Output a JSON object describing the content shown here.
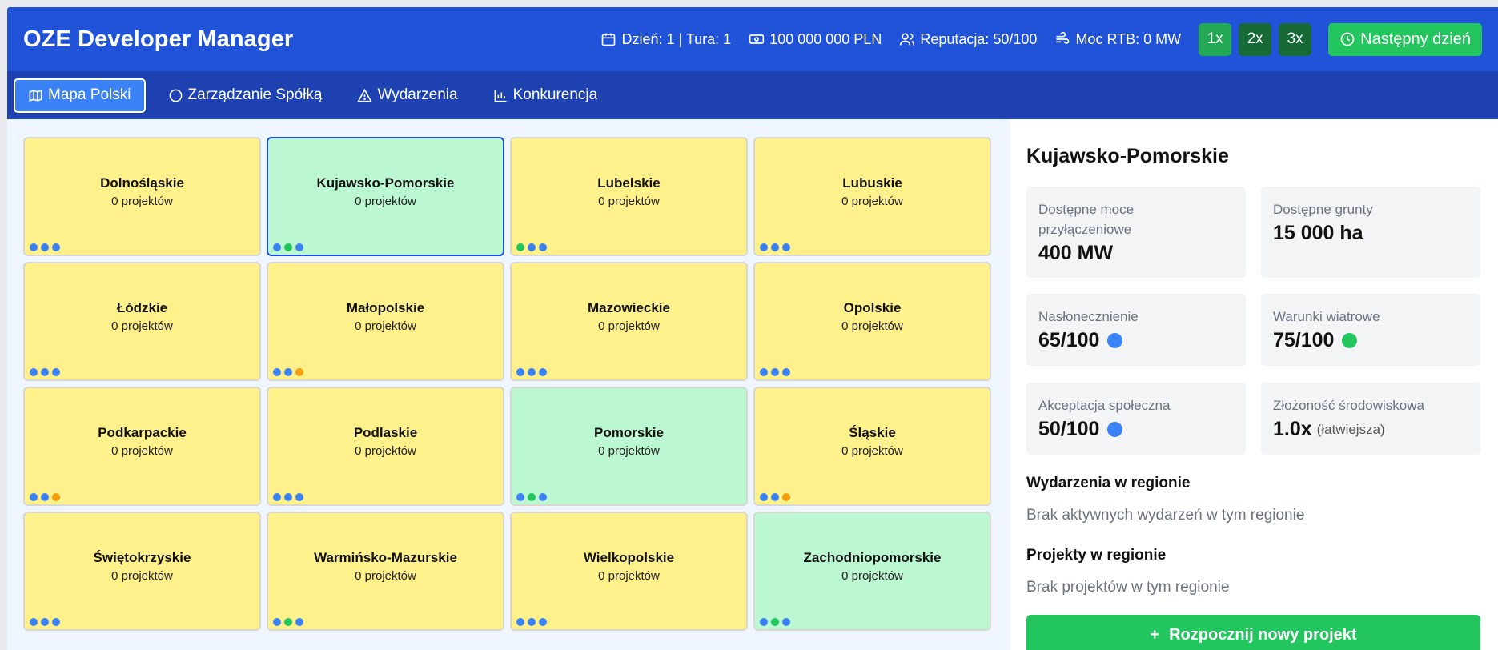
{
  "app": {
    "title": "OZE Developer Manager"
  },
  "stats": {
    "day": "Dzień: 1 | Tura: 1",
    "money": "100 000 000 PLN",
    "reputation": "Reputacja: 50/100",
    "power": "Moc RTB: 0 MW"
  },
  "speed": [
    {
      "label": "1x",
      "active": true
    },
    {
      "label": "2x",
      "active": false
    },
    {
      "label": "3x",
      "active": false
    }
  ],
  "next_day_label": "Następny dzień",
  "tabs": [
    {
      "label": "Mapa Polski",
      "icon": "map-icon",
      "active": true
    },
    {
      "label": "Zarządzanie Spółką",
      "icon": "circle-icon",
      "active": false
    },
    {
      "label": "Wydarzenia",
      "icon": "warning-icon",
      "active": false
    },
    {
      "label": "Konkurencja",
      "icon": "bar-chart-icon",
      "active": false
    }
  ],
  "colors": {
    "header": "#2153d9",
    "nav": "#1f42b3",
    "tile_yellow": "#fef08a",
    "tile_green": "#bbf7d0",
    "dot_blue": "#3b82f6",
    "dot_green": "#22c55e",
    "dot_orange": "#f59e0b",
    "button_green": "#22c55e"
  },
  "regions": [
    {
      "name": "Dolnośląskie",
      "count": "0 projektów",
      "color": "yellow",
      "dots": [
        "blue",
        "blue",
        "blue"
      ],
      "selected": false
    },
    {
      "name": "Kujawsko-Pomorskie",
      "count": "0 projektów",
      "color": "green",
      "dots": [
        "blue",
        "green",
        "blue"
      ],
      "selected": true
    },
    {
      "name": "Lubelskie",
      "count": "0 projektów",
      "color": "yellow",
      "dots": [
        "green",
        "blue",
        "blue"
      ],
      "selected": false
    },
    {
      "name": "Lubuskie",
      "count": "0 projektów",
      "color": "yellow",
      "dots": [
        "blue",
        "blue",
        "blue"
      ],
      "selected": false
    },
    {
      "name": "Łódzkie",
      "count": "0 projektów",
      "color": "yellow",
      "dots": [
        "blue",
        "blue",
        "blue"
      ],
      "selected": false
    },
    {
      "name": "Małopolskie",
      "count": "0 projektów",
      "color": "yellow",
      "dots": [
        "blue",
        "blue",
        "orange"
      ],
      "selected": false
    },
    {
      "name": "Mazowieckie",
      "count": "0 projektów",
      "color": "yellow",
      "dots": [
        "blue",
        "blue",
        "blue"
      ],
      "selected": false
    },
    {
      "name": "Opolskie",
      "count": "0 projektów",
      "color": "yellow",
      "dots": [
        "blue",
        "blue",
        "blue"
      ],
      "selected": false
    },
    {
      "name": "Podkarpackie",
      "count": "0 projektów",
      "color": "yellow",
      "dots": [
        "blue",
        "blue",
        "orange"
      ],
      "selected": false
    },
    {
      "name": "Podlaskie",
      "count": "0 projektów",
      "color": "yellow",
      "dots": [
        "blue",
        "blue",
        "blue"
      ],
      "selected": false
    },
    {
      "name": "Pomorskie",
      "count": "0 projektów",
      "color": "green",
      "dots": [
        "blue",
        "green",
        "blue"
      ],
      "selected": false
    },
    {
      "name": "Śląskie",
      "count": "0 projektów",
      "color": "yellow",
      "dots": [
        "blue",
        "blue",
        "orange"
      ],
      "selected": false
    },
    {
      "name": "Świętokrzyskie",
      "count": "0 projektów",
      "color": "yellow",
      "dots": [
        "blue",
        "blue",
        "blue"
      ],
      "selected": false
    },
    {
      "name": "Warmińsko-Mazurskie",
      "count": "0 projektów",
      "color": "yellow",
      "dots": [
        "blue",
        "green",
        "blue"
      ],
      "selected": false
    },
    {
      "name": "Wielkopolskie",
      "count": "0 projektów",
      "color": "yellow",
      "dots": [
        "blue",
        "blue",
        "blue"
      ],
      "selected": false
    },
    {
      "name": "Zachodniopomorskie",
      "count": "0 projektów",
      "color": "green",
      "dots": [
        "blue",
        "green",
        "blue"
      ],
      "selected": false
    }
  ],
  "detail": {
    "title": "Kujawsko-Pomorskie",
    "cards": {
      "capacity": {
        "label": "Dostępne moce przyłączeniowe",
        "value": "400 MW"
      },
      "land": {
        "label": "Dostępne grunty",
        "value": "15 000 ha"
      },
      "sun": {
        "label": "Nasłonecznienie",
        "value": "65/100",
        "dot": "blue"
      },
      "wind": {
        "label": "Warunki wiatrowe",
        "value": "75/100",
        "dot": "green"
      },
      "social": {
        "label": "Akceptacja społeczna",
        "value": "50/100",
        "dot": "blue"
      },
      "env": {
        "label": "Złożoność środowiskowa",
        "value": "1.0x",
        "suffix": "(łatwiejsza)"
      }
    },
    "events_heading": "Wydarzenia w regionie",
    "events_empty": "Brak aktywnych wydarzeń w tym regionie",
    "projects_heading": "Projekty w regionie",
    "projects_empty": "Brak projektów w tym regionie",
    "new_project": "Rozpocznij nowy projekt",
    "new_project_icon": "+"
  }
}
